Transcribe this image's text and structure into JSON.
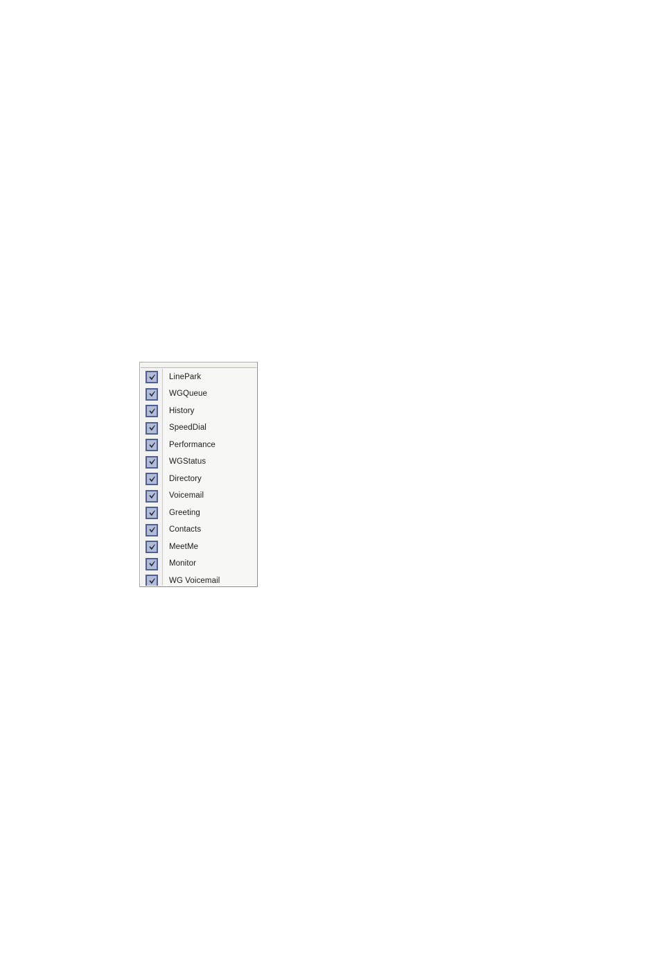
{
  "panel": {
    "name": "component-checklist",
    "header_label": "",
    "colors": {
      "panel_background": "#f7f7f5",
      "panel_border": "#a9a9a3",
      "gutter_background": "#f2f2f0",
      "checkbox_fill": "#b3bcd6",
      "checkbox_border": "#4f5f91",
      "checkmark": "#1c2440",
      "label_text": "#1a1a1a",
      "page_background": "#ffffff"
    },
    "items": [
      {
        "label": "LinePark",
        "checked": true
      },
      {
        "label": "WGQueue",
        "checked": true
      },
      {
        "label": "History",
        "checked": true
      },
      {
        "label": "SpeedDial",
        "checked": true
      },
      {
        "label": "Performance",
        "checked": true
      },
      {
        "label": "WGStatus",
        "checked": true
      },
      {
        "label": "Directory",
        "checked": true
      },
      {
        "label": "Voicemail",
        "checked": true
      },
      {
        "label": "Greeting",
        "checked": true
      },
      {
        "label": "Contacts",
        "checked": true
      },
      {
        "label": "MeetMe",
        "checked": true
      },
      {
        "label": "Monitor",
        "checked": true
      },
      {
        "label": "WG Voicemail",
        "checked": true
      }
    ]
  }
}
